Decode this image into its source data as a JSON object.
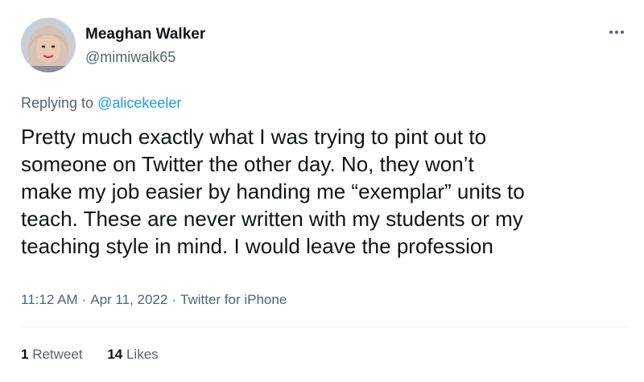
{
  "author": {
    "name": "Meaghan Walker",
    "handle": "@mimiwalk65"
  },
  "reply": {
    "prefix": "Replying to ",
    "to": "@alicekeeler"
  },
  "tweet": {
    "lines": [
      "Pretty much exactly what I was trying to pint out to",
      "someone on Twitter the other day. No, they won’t",
      "make my job easier by handing me “exemplar” units to",
      "teach. These are never written with my students or my",
      "teaching style in mind. I would leave the profession"
    ]
  },
  "meta": {
    "time": "11:12 AM",
    "separator": "·",
    "date": "Apr 11, 2022",
    "source": "Twitter for iPhone"
  },
  "stats": {
    "retweets_count": "1",
    "retweets_label": "Retweet",
    "likes_count": "14",
    "likes_label": "Likes"
  },
  "icons": {
    "more": "more-horizontal-icon"
  },
  "colors": {
    "text": "#0f1419",
    "secondary": "#536471",
    "link": "#1d9bf0",
    "divider": "#eff3f4"
  }
}
